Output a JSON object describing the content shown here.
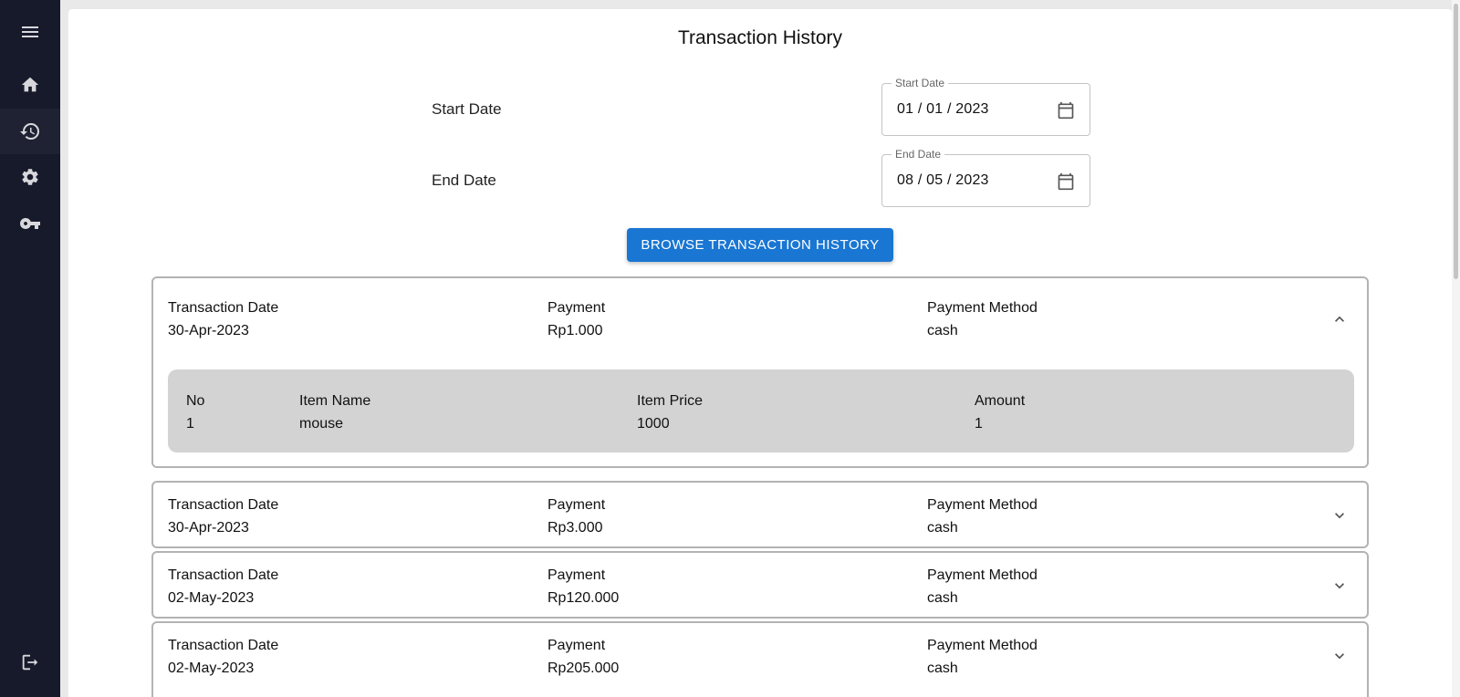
{
  "nav": {
    "items": [
      {
        "icon": "menu-icon"
      },
      {
        "icon": "home-icon"
      },
      {
        "icon": "history-icon",
        "active": true
      },
      {
        "icon": "gear-icon"
      },
      {
        "icon": "key-icon"
      },
      {
        "icon": "logout-icon"
      }
    ]
  },
  "page": {
    "title": "Transaction History"
  },
  "filters": {
    "start_label": "Start Date",
    "start_legend": "Start Date",
    "start_value": "01 / 01 / 2023",
    "end_label": "End Date",
    "end_legend": "End Date",
    "end_value": "08 / 05 / 2023",
    "browse_label": "BROWSE TRANSACTION HISTORY"
  },
  "labels": {
    "transaction_date": "Transaction Date",
    "payment": "Payment",
    "payment_method": "Payment Method",
    "no": "No",
    "item_name": "Item Name",
    "item_price": "Item Price",
    "amount": "Amount"
  },
  "transactions": [
    {
      "date": "30-Apr-2023",
      "payment": "Rp1.000",
      "method": "cash",
      "expanded": true,
      "items": [
        {
          "no": "1",
          "name": "mouse",
          "price": "1000",
          "amount": "1"
        }
      ]
    },
    {
      "date": "30-Apr-2023",
      "payment": "Rp3.000",
      "method": "cash",
      "expanded": false
    },
    {
      "date": "02-May-2023",
      "payment": "Rp120.000",
      "method": "cash",
      "expanded": false
    },
    {
      "date": "02-May-2023",
      "payment": "Rp205.000",
      "method": "cash",
      "expanded": false
    }
  ],
  "colors": {
    "sidebar": "#161a2b",
    "primary": "#1976d2",
    "details_bg": "#d3d3d3"
  }
}
